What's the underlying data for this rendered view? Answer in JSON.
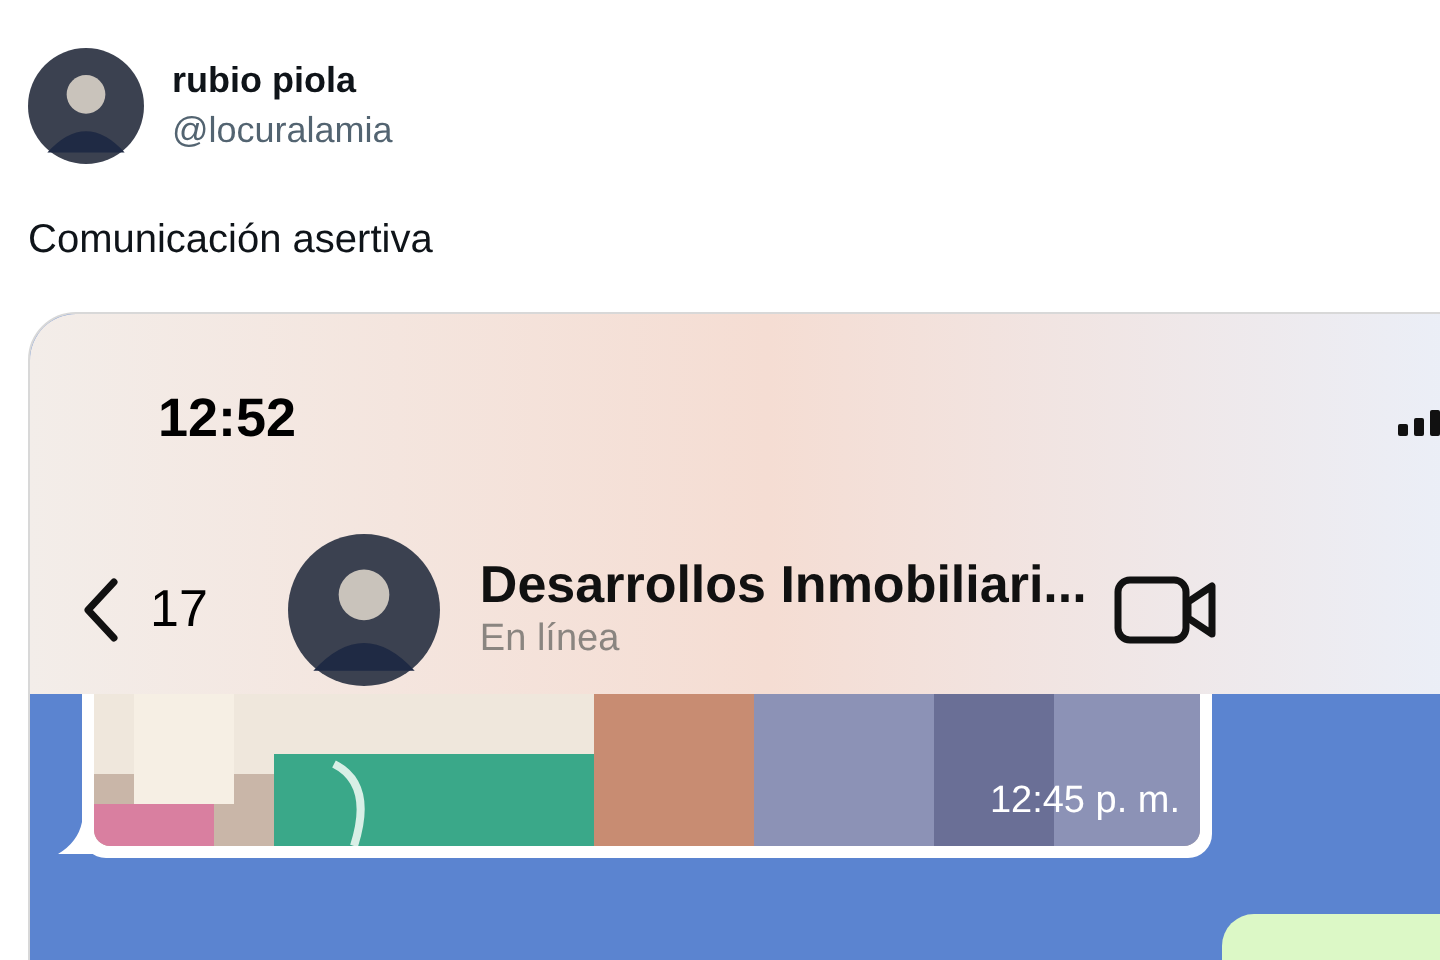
{
  "tweet": {
    "author_name": "rubio piola",
    "handle": "@locuralamia",
    "text": "Comunicación asertiva"
  },
  "screenshot": {
    "status_bar": {
      "time": "12:52"
    },
    "chat_header": {
      "back_count": "17",
      "contact_name": "Desarrollos Inmobiliari...",
      "status": "En línea"
    },
    "messages": [
      {
        "time": "12:45 p. m."
      },
      {
        "kind": "outgoing"
      }
    ]
  }
}
